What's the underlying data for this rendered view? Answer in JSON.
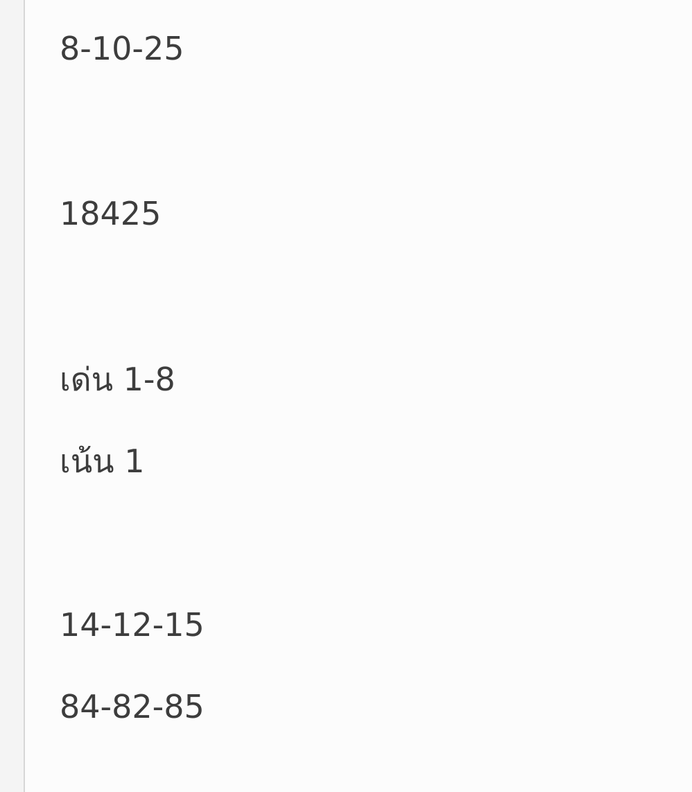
{
  "message": {
    "lines": [
      "8-10-25",
      "18425",
      "เด่น 1-8",
      "เน้น 1",
      "14-12-15",
      "84-82-85"
    ]
  }
}
